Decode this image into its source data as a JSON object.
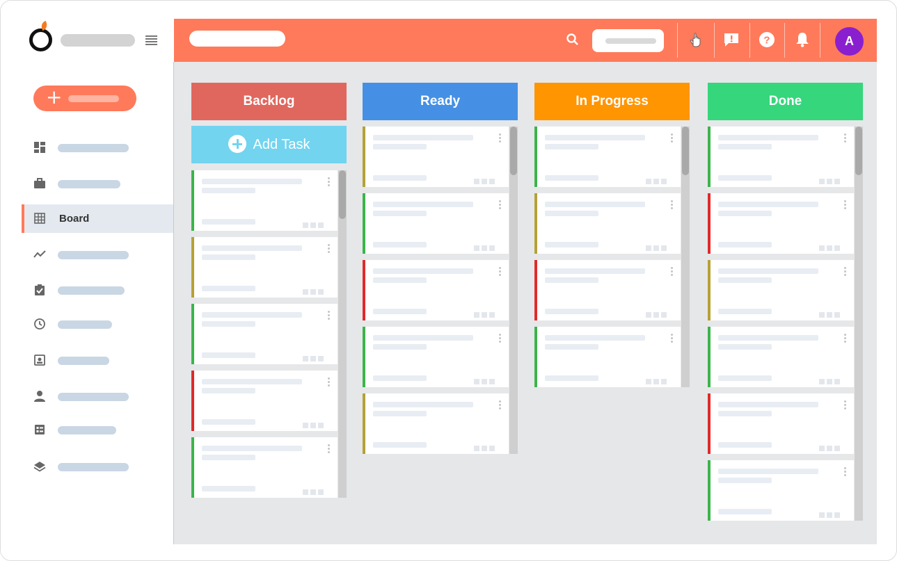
{
  "header": {
    "avatar_initial": "A"
  },
  "sidebar": {
    "active_label": "Board",
    "items": [
      {
        "icon": "dashboard-icon"
      },
      {
        "icon": "briefcase-icon"
      },
      {
        "icon": "board-grid-icon",
        "label": "Board"
      },
      {
        "icon": "trend-icon"
      },
      {
        "icon": "clipboard-check-icon"
      },
      {
        "icon": "clock-icon"
      },
      {
        "icon": "contact-card-icon"
      },
      {
        "icon": "person-icon"
      },
      {
        "icon": "list-detail-icon"
      },
      {
        "icon": "layers-icon"
      }
    ]
  },
  "board": {
    "add_task_label": "Add Task",
    "columns": [
      {
        "title": "Backlog",
        "color": "#e0675e",
        "card_colors": [
          "#3cb44b",
          "#b5a136",
          "#3cb44b",
          "#e02a2a",
          "#3cb44b"
        ]
      },
      {
        "title": "Ready",
        "color": "#4590e4",
        "card_colors": [
          "#b5a136",
          "#3cb44b",
          "#e02a2a",
          "#3cb44b",
          "#b5a136"
        ]
      },
      {
        "title": "In Progress",
        "color": "#ff9500",
        "card_colors": [
          "#3cb44b",
          "#b5a136",
          "#e02a2a",
          "#3cb44b"
        ]
      },
      {
        "title": "Done",
        "color": "#36d67c",
        "card_colors": [
          "#3cb44b",
          "#e02a2a",
          "#b5a136",
          "#3cb44b",
          "#e02a2a",
          "#3cb44b"
        ]
      }
    ]
  },
  "colors": {
    "accent": "#ff7a5a",
    "avatar": "#8a1fcf",
    "board_bg": "#e6e7e9"
  }
}
